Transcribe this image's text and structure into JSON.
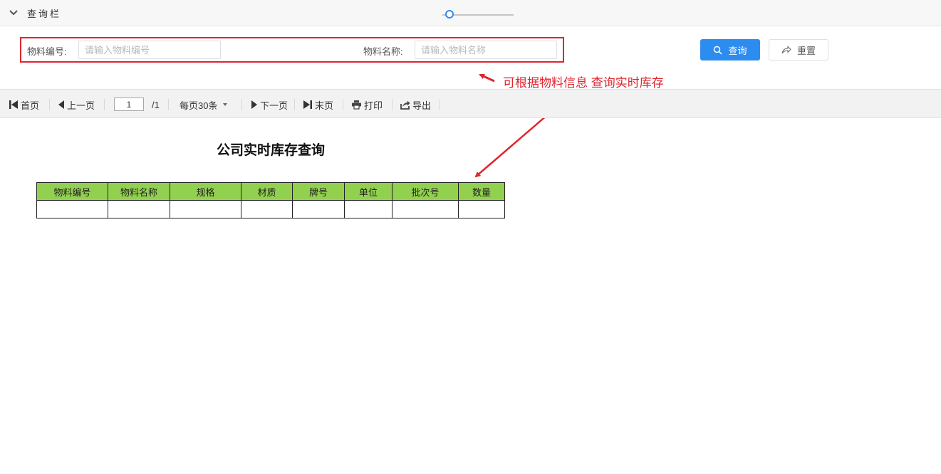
{
  "query_bar": {
    "title": "查询栏",
    "fields": [
      {
        "label": "物料编号:",
        "placeholder": "请输入物料编号",
        "value": ""
      },
      {
        "label": "物料名称:",
        "placeholder": "请输入物料名称",
        "value": ""
      }
    ],
    "query_label": "查询",
    "reset_label": "重置"
  },
  "annotation": {
    "text": "可根据物料信息 查询实时库存",
    "color": "#e0252e"
  },
  "toolbar": {
    "first_label": "首页",
    "prev_label": "上一页",
    "current_page": "1",
    "total_pages": "/1",
    "page_size_label": "每页30条",
    "next_label": "下一页",
    "last_label": "末页",
    "print_label": "打印",
    "export_label": "导出",
    "zoom_level": 0.1
  },
  "report": {
    "title": "公司实时库存查询",
    "columns": [
      "物料编号",
      "物料名称",
      "规格",
      "材质",
      "牌号",
      "单位",
      "批次号",
      "数量"
    ],
    "rows": [
      [
        "",
        "",
        "",
        "",
        "",
        "",
        "",
        ""
      ]
    ],
    "header_color": "#92d050"
  },
  "colors": {
    "primary": "#2d8cf0",
    "highlight": "#e0252e"
  }
}
